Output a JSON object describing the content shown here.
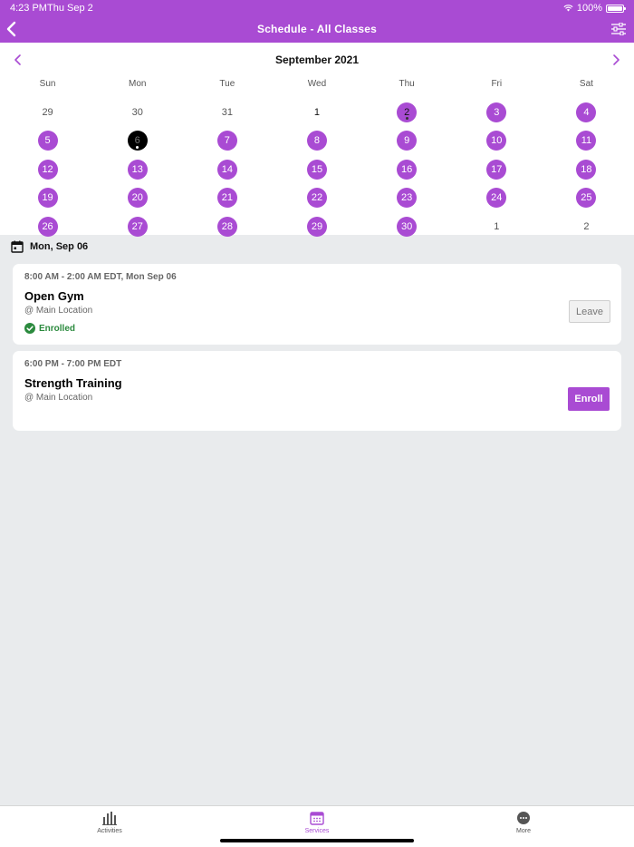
{
  "status": {
    "time": "4:23 PM",
    "date": "Thu Sep 2",
    "battery": "100%"
  },
  "nav": {
    "title": "Schedule - All Classes",
    "back_icon": "chevron-left-icon",
    "filter_icon": "sliders-icon"
  },
  "calendar": {
    "month": "September 2021",
    "weekdays": [
      "Sun",
      "Mon",
      "Tue",
      "Wed",
      "Thu",
      "Fri",
      "Sat"
    ],
    "days": [
      {
        "label": "29",
        "state": "outside"
      },
      {
        "label": "30",
        "state": "outside"
      },
      {
        "label": "31",
        "state": "outside"
      },
      {
        "label": "1",
        "state": "in-month"
      },
      {
        "label": "2",
        "state": "today"
      },
      {
        "label": "3",
        "state": "event"
      },
      {
        "label": "4",
        "state": "event"
      },
      {
        "label": "5",
        "state": "event"
      },
      {
        "label": "6",
        "state": "selected"
      },
      {
        "label": "7",
        "state": "event"
      },
      {
        "label": "8",
        "state": "event"
      },
      {
        "label": "9",
        "state": "event"
      },
      {
        "label": "10",
        "state": "event"
      },
      {
        "label": "11",
        "state": "event"
      },
      {
        "label": "12",
        "state": "event"
      },
      {
        "label": "13",
        "state": "event"
      },
      {
        "label": "14",
        "state": "event"
      },
      {
        "label": "15",
        "state": "event"
      },
      {
        "label": "16",
        "state": "event"
      },
      {
        "label": "17",
        "state": "event"
      },
      {
        "label": "18",
        "state": "event"
      },
      {
        "label": "19",
        "state": "event"
      },
      {
        "label": "20",
        "state": "event"
      },
      {
        "label": "21",
        "state": "event"
      },
      {
        "label": "22",
        "state": "event"
      },
      {
        "label": "23",
        "state": "event"
      },
      {
        "label": "24",
        "state": "event"
      },
      {
        "label": "25",
        "state": "event"
      },
      {
        "label": "26",
        "state": "event"
      },
      {
        "label": "27",
        "state": "event"
      },
      {
        "label": "28",
        "state": "event"
      },
      {
        "label": "29",
        "state": "event"
      },
      {
        "label": "30",
        "state": "event"
      },
      {
        "label": "1",
        "state": "outside"
      },
      {
        "label": "2",
        "state": "outside"
      }
    ]
  },
  "selected_date": "Mon, Sep 06",
  "classes": [
    {
      "time": "8:00 AM - 2:00 AM EDT, Mon Sep 06",
      "title": "Open Gym",
      "location": "@ Main Location",
      "status": "Enrolled",
      "action": "Leave"
    },
    {
      "time": "6:00 PM - 7:00 PM EDT",
      "title": "Strength Training",
      "location": "@ Main Location",
      "action": "Enroll"
    }
  ],
  "tabs": [
    {
      "label": "Activities",
      "icon": "bar-chart-icon"
    },
    {
      "label": "Services",
      "icon": "calendar-icon"
    },
    {
      "label": "More",
      "icon": "more-dots-icon"
    }
  ],
  "colors": {
    "accent": "#a94bd3",
    "enrolled": "#2b8a3e",
    "background": "#e9ebed"
  }
}
